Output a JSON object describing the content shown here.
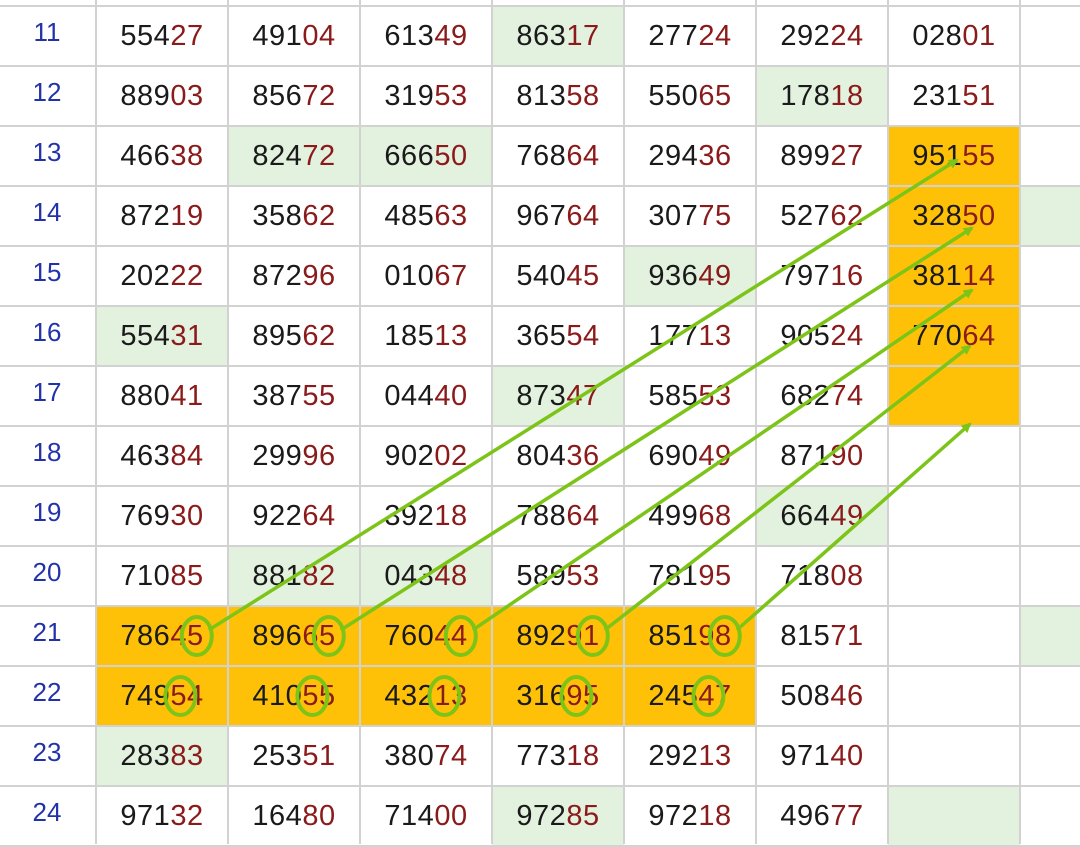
{
  "table": {
    "rows": [
      {
        "label": "11",
        "cells": [
          "55427",
          "49104",
          "61349",
          "86317",
          "27724",
          "29224",
          "02801"
        ]
      },
      {
        "label": "12",
        "cells": [
          "88903",
          "85672",
          "31953",
          "81358",
          "55065",
          "17818",
          "23151"
        ]
      },
      {
        "label": "13",
        "cells": [
          "46638",
          "82472",
          "66650",
          "76864",
          "29436",
          "89927",
          "95155"
        ]
      },
      {
        "label": "14",
        "cells": [
          "87219",
          "35862",
          "48563",
          "96764",
          "30775",
          "52762",
          "32850"
        ]
      },
      {
        "label": "15",
        "cells": [
          "20222",
          "87296",
          "01067",
          "54045",
          "93649",
          "79716",
          "38114"
        ]
      },
      {
        "label": "16",
        "cells": [
          "55431",
          "89562",
          "18513",
          "36554",
          "17713",
          "90524",
          "77064"
        ]
      },
      {
        "label": "17",
        "cells": [
          "88041",
          "38755",
          "04440",
          "87347",
          "58553",
          "68274",
          ""
        ]
      },
      {
        "label": "18",
        "cells": [
          "46384",
          "29996",
          "90202",
          "80436",
          "69049",
          "87190",
          ""
        ]
      },
      {
        "label": "19",
        "cells": [
          "76930",
          "92264",
          "39218",
          "78864",
          "49968",
          "66449",
          ""
        ]
      },
      {
        "label": "20",
        "cells": [
          "71085",
          "88182",
          "04348",
          "58953",
          "78195",
          "71808",
          ""
        ]
      },
      {
        "label": "21",
        "cells": [
          "78645",
          "89665",
          "76044",
          "89291",
          "85198",
          "81571",
          ""
        ]
      },
      {
        "label": "22",
        "cells": [
          "74954",
          "41055",
          "43213",
          "31695",
          "24547",
          "50846",
          ""
        ]
      },
      {
        "label": "23",
        "cells": [
          "28383",
          "25351",
          "38074",
          "77318",
          "29213",
          "97140",
          ""
        ]
      },
      {
        "label": "24",
        "cells": [
          "97132",
          "16480",
          "71400",
          "97285",
          "97218",
          "49677",
          ""
        ]
      }
    ],
    "highlights": {
      "green": [
        [
          0,
          3
        ],
        [
          1,
          5
        ],
        [
          2,
          1
        ],
        [
          2,
          2
        ],
        [
          5,
          0
        ],
        [
          4,
          4
        ],
        [
          6,
          3
        ],
        [
          8,
          5
        ],
        [
          9,
          1
        ],
        [
          9,
          2
        ],
        [
          12,
          0
        ],
        [
          13,
          3
        ],
        [
          13,
          6
        ]
      ],
      "orange": [
        [
          2,
          6
        ],
        [
          3,
          6
        ],
        [
          4,
          6
        ],
        [
          5,
          6
        ],
        [
          6,
          6
        ],
        [
          10,
          0
        ],
        [
          10,
          1
        ],
        [
          10,
          2
        ],
        [
          10,
          3
        ],
        [
          10,
          4
        ],
        [
          11,
          0
        ],
        [
          11,
          1
        ],
        [
          11,
          2
        ],
        [
          11,
          3
        ],
        [
          11,
          4
        ]
      ]
    }
  },
  "colors": {
    "grid_line": "#d2d2d2",
    "green_highlight": "#e3f1df",
    "orange_highlight": "#ffc107",
    "arrow": "#7cc418",
    "row_label": "#2233aa",
    "digit_dark": "#1a1a1a",
    "digit_red": "#8b1a1a"
  },
  "annotations": {
    "circle_positions": [
      {
        "row": 10,
        "col": 0,
        "digit": 4
      },
      {
        "row": 10,
        "col": 1,
        "digit": 4
      },
      {
        "row": 10,
        "col": 2,
        "digit": 4
      },
      {
        "row": 10,
        "col": 3,
        "digit": 4
      },
      {
        "row": 10,
        "col": 4,
        "digit": 4
      },
      {
        "row": 11,
        "col": 0,
        "digit": 3
      },
      {
        "row": 11,
        "col": 1,
        "digit": 3
      },
      {
        "row": 11,
        "col": 2,
        "digit": 3
      },
      {
        "row": 11,
        "col": 3,
        "digit": 3
      },
      {
        "row": 11,
        "col": 4,
        "digit": 3
      }
    ],
    "arrows": [
      {
        "from": [
          10,
          0
        ],
        "to": [
          2,
          6
        ]
      },
      {
        "from": [
          10,
          1
        ],
        "to": [
          3,
          6
        ]
      },
      {
        "from": [
          10,
          2
        ],
        "to": [
          4,
          6
        ]
      },
      {
        "from": [
          10,
          3
        ],
        "to": [
          5,
          6
        ]
      },
      {
        "from": [
          10,
          4
        ],
        "to": [
          6,
          6
        ]
      }
    ]
  }
}
